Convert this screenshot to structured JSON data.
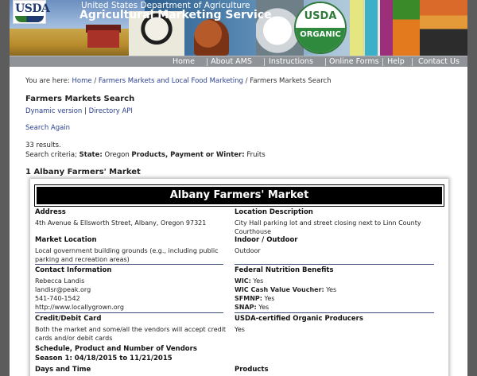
{
  "header": {
    "logo_text": "USDA",
    "agency_line1": "United States Department of Agriculture",
    "agency_line2": "Agricultural Marketing Service",
    "seal_top": "USDA",
    "seal_bottom": "ORGANIC"
  },
  "nav": {
    "items": [
      {
        "label": "Home"
      },
      {
        "label": "About AMS"
      },
      {
        "label": "Instructions"
      },
      {
        "label": "Online Forms"
      },
      {
        "label": "Help"
      },
      {
        "label": "Contact Us"
      }
    ]
  },
  "breadcrumb": {
    "prefix": "You are here:",
    "home": "Home",
    "sep": "/",
    "section": "Farmers Markets and Local Food Marketing",
    "current": "Farmers Markets Search"
  },
  "page": {
    "title": "Farmers Markets Search",
    "dynamic_link": "Dynamic version",
    "link_sep": "|",
    "api_link": "Directory API",
    "search_again": "Search Again",
    "results_count": "33 results.",
    "criteria_prefix": "Search criteria;",
    "criteria_state_label": "State:",
    "criteria_state_value": "Oregon",
    "criteria_products_label": "Products, Payment or Winter:",
    "criteria_products_value": "Fruits"
  },
  "market": {
    "heading": "1 Albany Farmers' Market",
    "title": "Albany Farmers' Market",
    "address_label": "Address",
    "address": "4th Avenue & Ellsworth Street, Albany, Oregon 97321",
    "location_desc_label": "Location Description",
    "location_desc": "City Hall parking lot and street closing next to Linn County Courthouse",
    "market_location_label": "Market Location",
    "market_location": "Local government building grounds (e.g., including public parking and recreation areas)",
    "indoor_outdoor_label": "Indoor / Outdoor",
    "indoor_outdoor": "Outdoor",
    "contact_label": "Contact Information",
    "contact_name": "Rebecca Landis",
    "contact_email": "landisr@peak.org",
    "contact_phone": "541-740-1542",
    "contact_web": "http://www.locallygrown.org",
    "nutrition_label": "Federal Nutrition Benefits",
    "wic_label": "WIC:",
    "wic_value": "Yes",
    "wic_cash_label": "WIC Cash Value Voucher:",
    "wic_cash_value": "Yes",
    "sfmnp_label": "SFMNP:",
    "sfmnp_value": "Yes",
    "snap_label": "SNAP:",
    "snap_value": "Yes",
    "credit_label": "Credit/Debit Card",
    "credit_value": "Both the market and some/all the vendors will accept credit cards and/or debit cards",
    "organic_label": "USDA-certified Organic Producers",
    "organic_value": "Yes",
    "schedule_label": "Schedule, Product and Number of Vendors",
    "season_label": "Season 1: 04/18/2015 to 11/21/2015",
    "days_label": "Days and Time",
    "products_label": "Products"
  }
}
